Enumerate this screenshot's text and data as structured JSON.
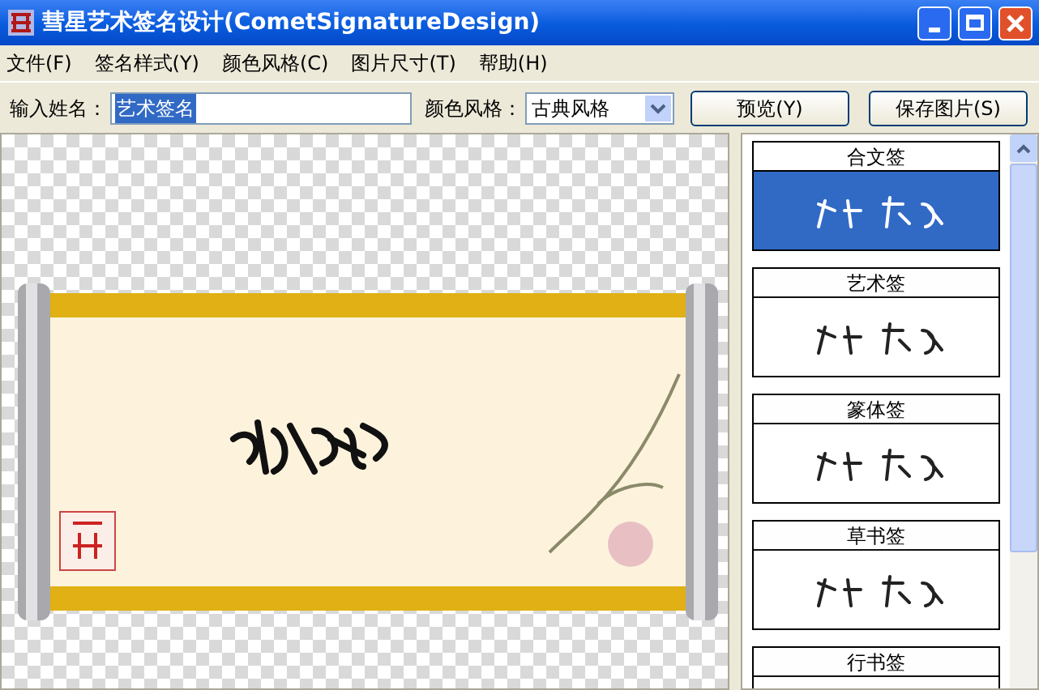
{
  "window": {
    "title": "彗星艺术签名设计(CometSignatureDesign)"
  },
  "menu": [
    {
      "label": "文件(F)"
    },
    {
      "label": "签名样式(Y)"
    },
    {
      "label": "颜色风格(C)"
    },
    {
      "label": "图片尺寸(T)"
    },
    {
      "label": "帮助(H)"
    }
  ],
  "toolbar": {
    "name_label": "输入姓名：",
    "name_value": "艺术签名",
    "style_label": "颜色风格：",
    "style_value": "古典风格",
    "buttons": [
      "预览(Y)",
      "保存图片(S)"
    ]
  },
  "styles": [
    {
      "label": "合文签",
      "selected": true
    },
    {
      "label": "艺术签",
      "selected": false
    },
    {
      "label": "篆体签",
      "selected": false
    },
    {
      "label": "草书签",
      "selected": false
    },
    {
      "label": "行书签",
      "selected": false
    }
  ]
}
